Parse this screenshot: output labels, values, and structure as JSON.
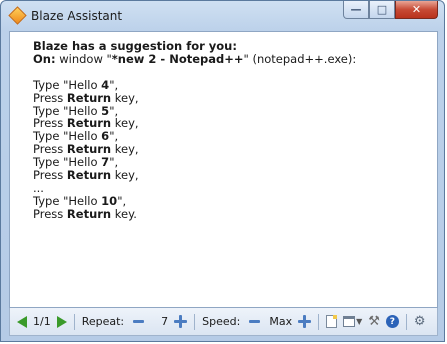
{
  "window": {
    "title": "Blaze Assistant"
  },
  "suggestion": {
    "headline": "Blaze has a suggestion for you:",
    "on_label": "On:",
    "on_text_pre": " window \"",
    "on_window": "*new 2 - Notepad++",
    "on_text_post": "\" (notepad++.exe):",
    "steps": [
      {
        "type_pre": "Type \"Hello ",
        "value": "4",
        "type_post": "\",",
        "press_pre": "Press ",
        "key": "Return",
        "press_post": " key,"
      },
      {
        "type_pre": "Type \"Hello ",
        "value": "5",
        "type_post": "\",",
        "press_pre": "Press ",
        "key": "Return",
        "press_post": " key,"
      },
      {
        "type_pre": "Type \"Hello ",
        "value": "6",
        "type_post": "\",",
        "press_pre": "Press ",
        "key": "Return",
        "press_post": " key,"
      },
      {
        "type_pre": "Type \"Hello ",
        "value": "7",
        "type_post": "\",",
        "press_pre": "Press ",
        "key": "Return",
        "press_post": " key,"
      }
    ],
    "ellipsis": "...",
    "final_step": {
      "type_pre": "Type \"Hello ",
      "value": "10",
      "type_post": "\",",
      "press_pre": "Press ",
      "key": "Return",
      "press_post": " key."
    }
  },
  "statusbar": {
    "page": "1/1",
    "repeat_label": "Repeat:",
    "repeat_value": "7",
    "speed_label": "Speed:",
    "speed_value": "Max"
  },
  "icons": {
    "prev": "arrow-left-icon",
    "next": "arrow-right-icon",
    "minus": "minus-icon",
    "plus": "plus-icon",
    "new": "document-icon",
    "window": "window-icon",
    "tools": "tools-icon",
    "help": "help-icon",
    "settings": "gear-icon"
  },
  "colors": {
    "accent_green": "#3a9a2a",
    "accent_blue": "#4b7cc1",
    "close_red": "#c74b36"
  }
}
